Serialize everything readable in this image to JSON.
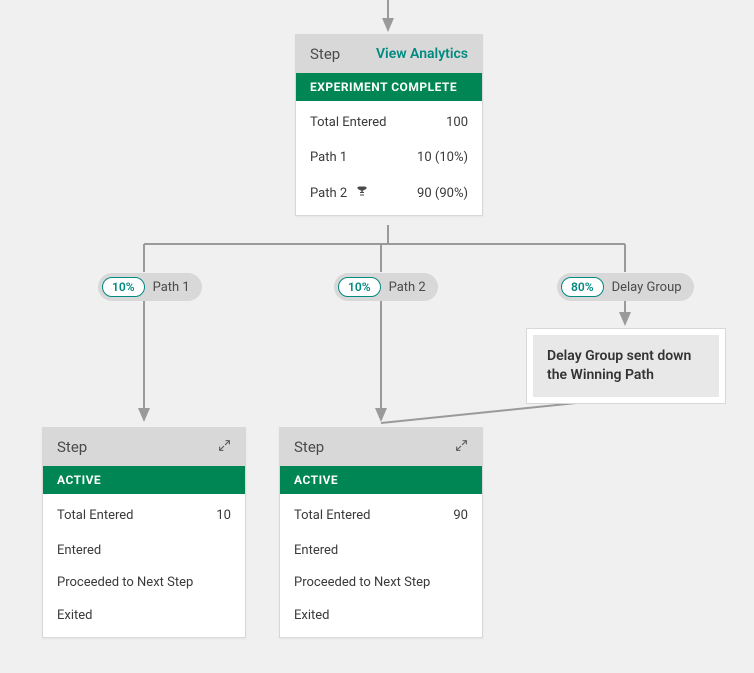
{
  "topCard": {
    "title": "Step",
    "link": "View Analytics",
    "status": "EXPERIMENT COMPLETE",
    "totalEnteredLabel": "Total Entered",
    "totalEnteredValue": "100",
    "path1Label": "Path 1",
    "path1Value": "10 (10%)",
    "path2Label": "Path 2",
    "path2Value": "90 (90%)"
  },
  "pills": {
    "p1": {
      "pct": "10%",
      "label": "Path 1"
    },
    "p2": {
      "pct": "10%",
      "label": "Path 2"
    },
    "p3": {
      "pct": "80%",
      "label": "Delay Group"
    }
  },
  "note": "Delay Group sent down the Winning Path",
  "leftCard": {
    "title": "Step",
    "status": "ACTIVE",
    "totalEnteredLabel": "Total Entered",
    "totalEnteredValue": "10",
    "enteredLabel": "Entered",
    "proceededLabel": "Proceeded to Next Step",
    "exitedLabel": "Exited"
  },
  "rightCard": {
    "title": "Step",
    "status": "ACTIVE",
    "totalEnteredLabel": "Total Entered",
    "totalEnteredValue": "90",
    "enteredLabel": "Entered",
    "proceededLabel": "Proceeded to Next Step",
    "exitedLabel": "Exited"
  }
}
